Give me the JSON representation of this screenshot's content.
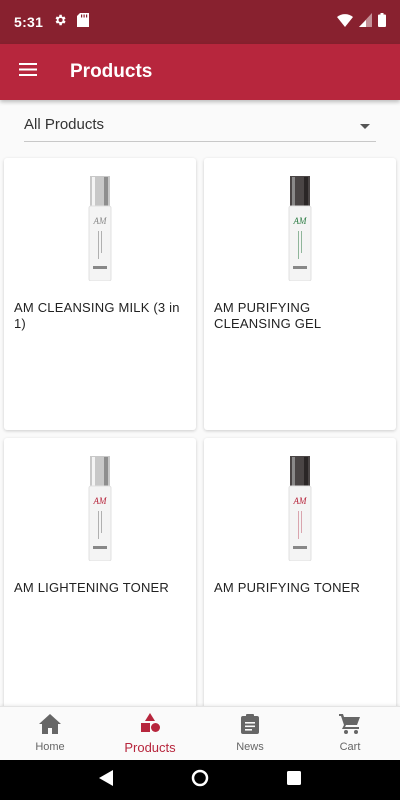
{
  "status_bar": {
    "time": "5:31",
    "icons": [
      "gear-icon",
      "sd-card-icon",
      "wifi-icon",
      "signal-icon",
      "battery-icon"
    ]
  },
  "app_bar": {
    "title": "Products",
    "menu_icon": "hamburger-menu-icon",
    "background": "#b7263d"
  },
  "filter": {
    "selected": "All Products",
    "icon": "dropdown-arrow-icon"
  },
  "products": [
    {
      "name": "AM CLEANSING MILK (3 in 1)",
      "accent": "#8a8a8a"
    },
    {
      "name": "AM PURIFYING CLEANSING GEL",
      "accent": "#2e7d45"
    },
    {
      "name": "AM LIGHTENING TONER",
      "accent": "#8a8a8a"
    },
    {
      "name": "AM PURIFYING TONER",
      "accent": "#b7263d"
    }
  ],
  "bottom_nav": {
    "items": [
      {
        "label": "Home",
        "icon": "home-icon"
      },
      {
        "label": "Products",
        "icon": "shapes-icon"
      },
      {
        "label": "News",
        "icon": "clipboard-icon"
      },
      {
        "label": "Cart",
        "icon": "cart-icon"
      }
    ],
    "active": "Products",
    "active_color": "#b7263d"
  }
}
